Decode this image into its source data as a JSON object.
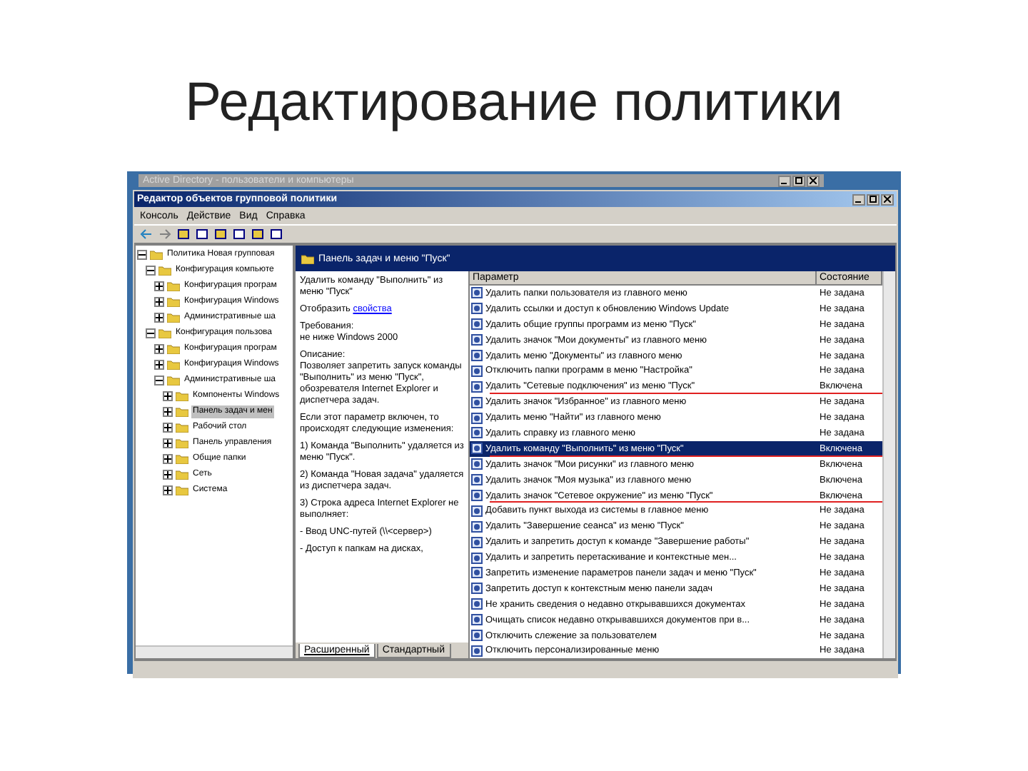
{
  "slide_title": "Редактирование политики",
  "background_window": {
    "title": "Active Directory - пользователи и компьютеры"
  },
  "window": {
    "title": "Редактор объектов групповой политики"
  },
  "menu": [
    "Консоль",
    "Действие",
    "Вид",
    "Справка"
  ],
  "tree": [
    {
      "label": "Политика Новая групповая",
      "expanded": true,
      "selected": false,
      "children": [
        {
          "label": "Конфигурация компьюте",
          "expanded": true,
          "selected": false,
          "children": [
            {
              "label": "Конфигурация програм",
              "expanded": false,
              "selected": false
            },
            {
              "label": "Конфигурация Windows",
              "expanded": false,
              "selected": false
            },
            {
              "label": "Административные ша",
              "expanded": false,
              "selected": false
            }
          ]
        },
        {
          "label": "Конфигурация пользова",
          "expanded": true,
          "selected": false,
          "children": [
            {
              "label": "Конфигурация програм",
              "expanded": false,
              "selected": false
            },
            {
              "label": "Конфигурация Windows",
              "expanded": false,
              "selected": false
            },
            {
              "label": "Административные ша",
              "expanded": true,
              "selected": false,
              "children": [
                {
                  "label": "Компоненты Windows",
                  "expanded": false,
                  "selected": false
                },
                {
                  "label": "Панель задач и мен",
                  "expanded": false,
                  "selected": true
                },
                {
                  "label": "Рабочий стол",
                  "expanded": false,
                  "selected": false
                },
                {
                  "label": "Панель управления",
                  "expanded": false,
                  "selected": false
                },
                {
                  "label": "Общие папки",
                  "expanded": false,
                  "selected": false
                },
                {
                  "label": "Сеть",
                  "expanded": false,
                  "selected": false
                },
                {
                  "label": "Система",
                  "expanded": false,
                  "selected": false
                }
              ]
            }
          ]
        }
      ]
    }
  ],
  "details_header": "Панель задач и меню \"Пуск\"",
  "details": {
    "title": "Удалить команду \"Выполнить\" из меню \"Пуск\"",
    "show_prefix": "Отобразить ",
    "show_link": "свойства",
    "paragraphs": [
      "Требования:\nне ниже Windows 2000",
      "Описание:\nПозволяет запретить запуск команды \"Выполнить\" из меню \"Пуск\", обозревателя Internet Explorer и диспетчера задач.",
      "Если этот параметр включен, то происходят следующие изменения:",
      "1) Команда \"Выполнить\" удаляется из меню \"Пуск\".",
      "2) Команда \"Новая задача\" удаляется из диспетчера задач.",
      "3) Строка адреса Internet Explorer не выполняет:",
      "- Ввод UNC-путей (\\\\<сервер>)",
      "- Доступ к папкам на дисках,"
    ]
  },
  "view_tabs": [
    {
      "label": "Расширенный",
      "selected": true
    },
    {
      "label": "Стандартный",
      "selected": false
    }
  ],
  "table": {
    "columns": [
      "Параметр",
      "Состояние"
    ],
    "rows": [
      {
        "name": "Удалить папки пользователя из главного меню",
        "state": "Не задана",
        "selected": false,
        "marked": false
      },
      {
        "name": "Удалить ссылки и доступ к обновлению Windows Update",
        "state": "Не задана",
        "selected": false,
        "marked": false
      },
      {
        "name": "Удалить общие группы программ из меню \"Пуск\"",
        "state": "Не задана",
        "selected": false,
        "marked": false
      },
      {
        "name": "Удалить значок \"Мои документы\" из главного меню",
        "state": "Не задана",
        "selected": false,
        "marked": false
      },
      {
        "name": "Удалить меню \"Документы\" из главного меню",
        "state": "Не задана",
        "selected": false,
        "marked": false
      },
      {
        "name": "Отключить папки программ в меню \"Настройка\"",
        "state": "Не задана",
        "selected": false,
        "marked": false
      },
      {
        "name": "Удалить \"Сетевые подключения\" из меню \"Пуск\"",
        "state": "Включена",
        "selected": false,
        "marked": true
      },
      {
        "name": "Удалить значок \"Избранное\" из главного меню",
        "state": "Не задана",
        "selected": false,
        "marked": false
      },
      {
        "name": "Удалить меню \"Найти\" из главного меню",
        "state": "Не задана",
        "selected": false,
        "marked": false
      },
      {
        "name": "Удалить справку из главного меню",
        "state": "Не задана",
        "selected": false,
        "marked": false
      },
      {
        "name": "Удалить команду \"Выполнить\" из меню \"Пуск\"",
        "state": "Включена",
        "selected": true,
        "marked": true
      },
      {
        "name": "Удалить значок \"Мои рисунки\" из главного меню",
        "state": "Включена",
        "selected": false,
        "marked": false
      },
      {
        "name": "Удалить значок \"Моя музыка\" из главного меню",
        "state": "Включена",
        "selected": false,
        "marked": false
      },
      {
        "name": "Удалить значок \"Сетевое окружение\" из меню \"Пуск\"",
        "state": "Включена",
        "selected": false,
        "marked": true
      },
      {
        "name": "Добавить пункт выхода из системы в главное меню",
        "state": "Не задана",
        "selected": false,
        "marked": false
      },
      {
        "name": "Удалить \"Завершение сеанса\" из меню \"Пуск\"",
        "state": "Не задана",
        "selected": false,
        "marked": false
      },
      {
        "name": "Удалить и запретить доступ к команде \"Завершение работы\"",
        "state": "Не задана",
        "selected": false,
        "marked": false
      },
      {
        "name": "Удалить и запретить перетаскивание и контекстные мен...",
        "state": "Не задана",
        "selected": false,
        "marked": false
      },
      {
        "name": "Запретить изменение параметров панели задач и меню \"Пуск\"",
        "state": "Не задана",
        "selected": false,
        "marked": false
      },
      {
        "name": "Запретить доступ к контекстным меню панели задач",
        "state": "Не задана",
        "selected": false,
        "marked": false
      },
      {
        "name": "Не хранить сведения о недавно открывавшихся документах",
        "state": "Не задана",
        "selected": false,
        "marked": false
      },
      {
        "name": "Очищать список недавно открывавшихся документов при в...",
        "state": "Не задана",
        "selected": false,
        "marked": false
      },
      {
        "name": "Отключить слежение за пользователем",
        "state": "Не задана",
        "selected": false,
        "marked": false
      },
      {
        "name": "Отключить персонализированные меню",
        "state": "Не задана",
        "selected": false,
        "marked": false
      }
    ]
  }
}
